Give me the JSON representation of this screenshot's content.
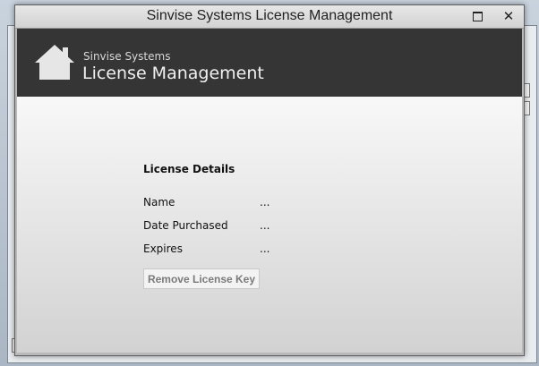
{
  "window": {
    "title": "Sinvise Systems License Management",
    "maximize_icon": "maximize-icon",
    "close_icon": "close-icon"
  },
  "header": {
    "company": "Sinvise Systems",
    "product": "License Management",
    "icon": "home-icon",
    "band_color": "#353535"
  },
  "license_details": {
    "heading": "License Details",
    "fields": [
      {
        "label": "Name",
        "value": "..."
      },
      {
        "label": "Date Purchased",
        "value": "..."
      },
      {
        "label": "Expires",
        "value": "..."
      }
    ]
  },
  "actions": {
    "remove_label": "Remove License Key"
  }
}
